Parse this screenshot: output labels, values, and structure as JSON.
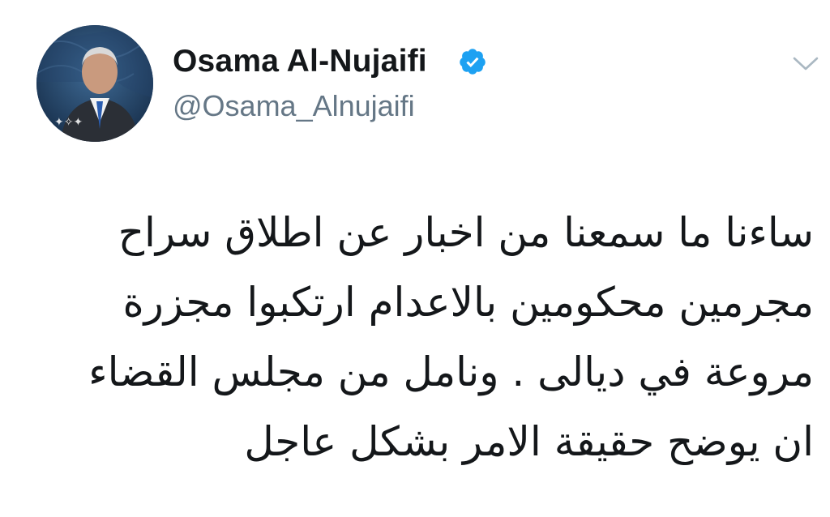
{
  "tweet": {
    "author": {
      "display_name": "Osama Al-Nujaifi",
      "handle": "@Osama_Alnujaifi",
      "verified": true,
      "avatar_icon": "profile-photo"
    },
    "menu_icon": "chevron-down-icon",
    "text_lines": [
      "ساءنا ما سمعنا من اخبار عن اطلاق سراح",
      "مجرمين محكومين بالاعدام ارتكبوا مجزرة",
      "مروعة في ديالى . ونامل من مجلس القضاء",
      "ان يوضح حقيقة الامر بشكل عاجل"
    ]
  },
  "colors": {
    "name": "#14171a",
    "handle": "#657786",
    "verified_badge": "#1da1f2",
    "chevron": "#aab8c2",
    "background": "#ffffff"
  }
}
